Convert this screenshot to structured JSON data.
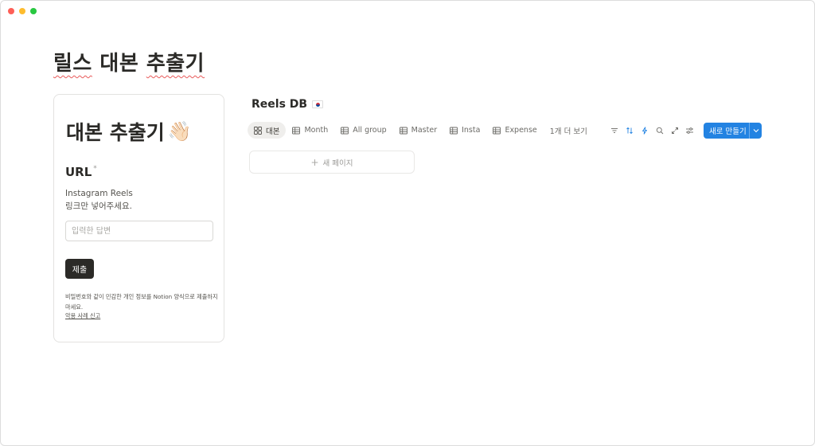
{
  "window": {
    "controls": [
      "close",
      "minimize",
      "zoom"
    ]
  },
  "page": {
    "title_part1": "릴스",
    "title_part2": "대본",
    "title_part3": "추출기"
  },
  "form": {
    "title": "대본 추출기",
    "title_emoji": "👋🏻",
    "field_label": "URL",
    "required_mark": "*",
    "field_desc_line1": "Instagram Reels",
    "field_desc_line2": "링크만 넣어주세요.",
    "input_placeholder": "입력한 답변",
    "input_value": "",
    "submit_label": "제출",
    "notice": "비밀번호와 같이 민감한 개인 정보를 Notion 양식으로 제출하지 마세요.",
    "report_link": "악용 사례 신고"
  },
  "database": {
    "title": "Reels DB",
    "title_flag": "south-korea-flag",
    "tabs": [
      {
        "label": "대본",
        "icon": "gallery-icon",
        "active": true
      },
      {
        "label": "Month",
        "icon": "table-icon",
        "active": false
      },
      {
        "label": "All group",
        "icon": "table-icon",
        "active": false
      },
      {
        "label": "Master",
        "icon": "table-icon",
        "active": false
      },
      {
        "label": "Insta",
        "icon": "table-icon",
        "active": false
      },
      {
        "label": "Expense",
        "icon": "table-icon",
        "active": false
      }
    ],
    "more_views": "1개 더 보기",
    "tools": [
      "filter-icon",
      "sort-icon",
      "automation-icon",
      "search-icon",
      "expand-icon",
      "settings-icon"
    ],
    "new_button": "새로 만들기",
    "new_page": "새 페이지"
  },
  "colors": {
    "accent": "#2383e2",
    "text": "#37352f",
    "submit_bg": "#2b2a27"
  }
}
